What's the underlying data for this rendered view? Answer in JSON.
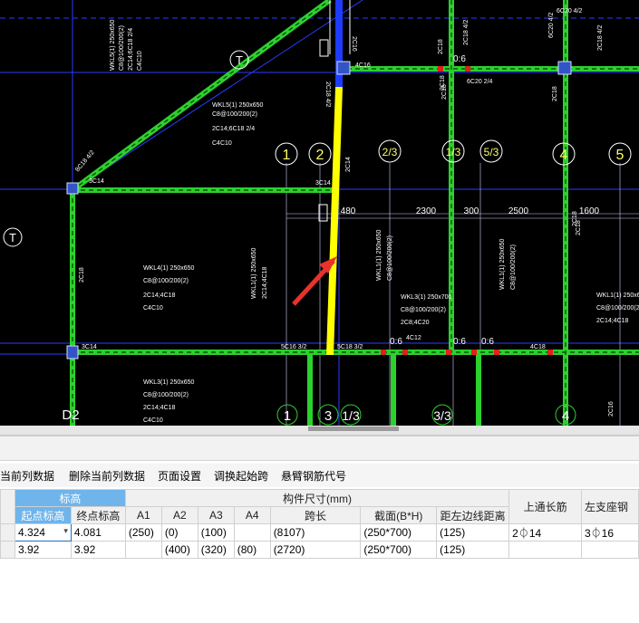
{
  "drawing": {
    "axis_labels": [
      "1",
      "2",
      "2/3",
      "1/3",
      "5/3",
      "4",
      "5",
      "1",
      "3",
      "1/3",
      "3/3",
      "4",
      "D2",
      "T",
      "T"
    ],
    "dims": [
      "2300",
      "300",
      "2500",
      "1600",
      "0:6",
      "0:6",
      "0:6",
      "0:6",
      "480"
    ],
    "beam_labels": [
      "WKL5(1) 250x650",
      "C8@100/200(2)",
      "2C14;6C18 2/4",
      "C4C10",
      "WKL4(1) 250x650",
      "C8@100/200(2)",
      "2C14;4C18",
      "C4C10",
      "WKL3(1) 250x650",
      "C8@100/200(2)",
      "2C14;4C18",
      "C4C10",
      "WKL1(1) 250x650",
      "C8@100/200(2)",
      "WKL3(1) 250x700",
      "C8@100/200(2)",
      "2C8;4C20",
      "WKL1(1) 250x650",
      "2C14;4C18",
      "2C18 4/2",
      "6C20 4/2",
      "6C20 2/4",
      "8C18 4/2",
      "3C14",
      "2C18",
      "2C16",
      "2C14",
      "4C16",
      "5C16 3/2",
      "5C18 3/2",
      "4C12",
      "4C18",
      "2C18"
    ]
  },
  "toolbar": {
    "items": [
      "当前列数据",
      "删除当前列数据",
      "页面设置",
      "调换起始跨",
      "悬臂钢筋代号"
    ]
  },
  "table": {
    "group_header_elev": "标高",
    "group_header_size": "构件尺寸(mm)",
    "headers": [
      "起点标高",
      "终点标高",
      "A1",
      "A2",
      "A3",
      "A4",
      "跨长",
      "截面(B*H)",
      "距左边线距离",
      "上通长筋",
      "左支座钢"
    ],
    "rows": [
      [
        "4.324",
        "4.081",
        "(250)",
        "(0)",
        "(100)",
        "",
        "(8107)",
        "(250*700)",
        "(125)",
        "2⏀14",
        "3⏀16"
      ],
      [
        "3.92",
        "3.92",
        "",
        "(400)",
        "(320)",
        "(80)",
        "(2720)",
        "(250*700)",
        "(125)",
        "",
        ""
      ]
    ]
  },
  "colors": {
    "beam": "#2cd12c",
    "grid_blue": "#2a3dff",
    "selected": "#ffff00",
    "arrow": "#e8322c",
    "text_white": "#ffffff",
    "header_blue": "#6fb4ea"
  }
}
